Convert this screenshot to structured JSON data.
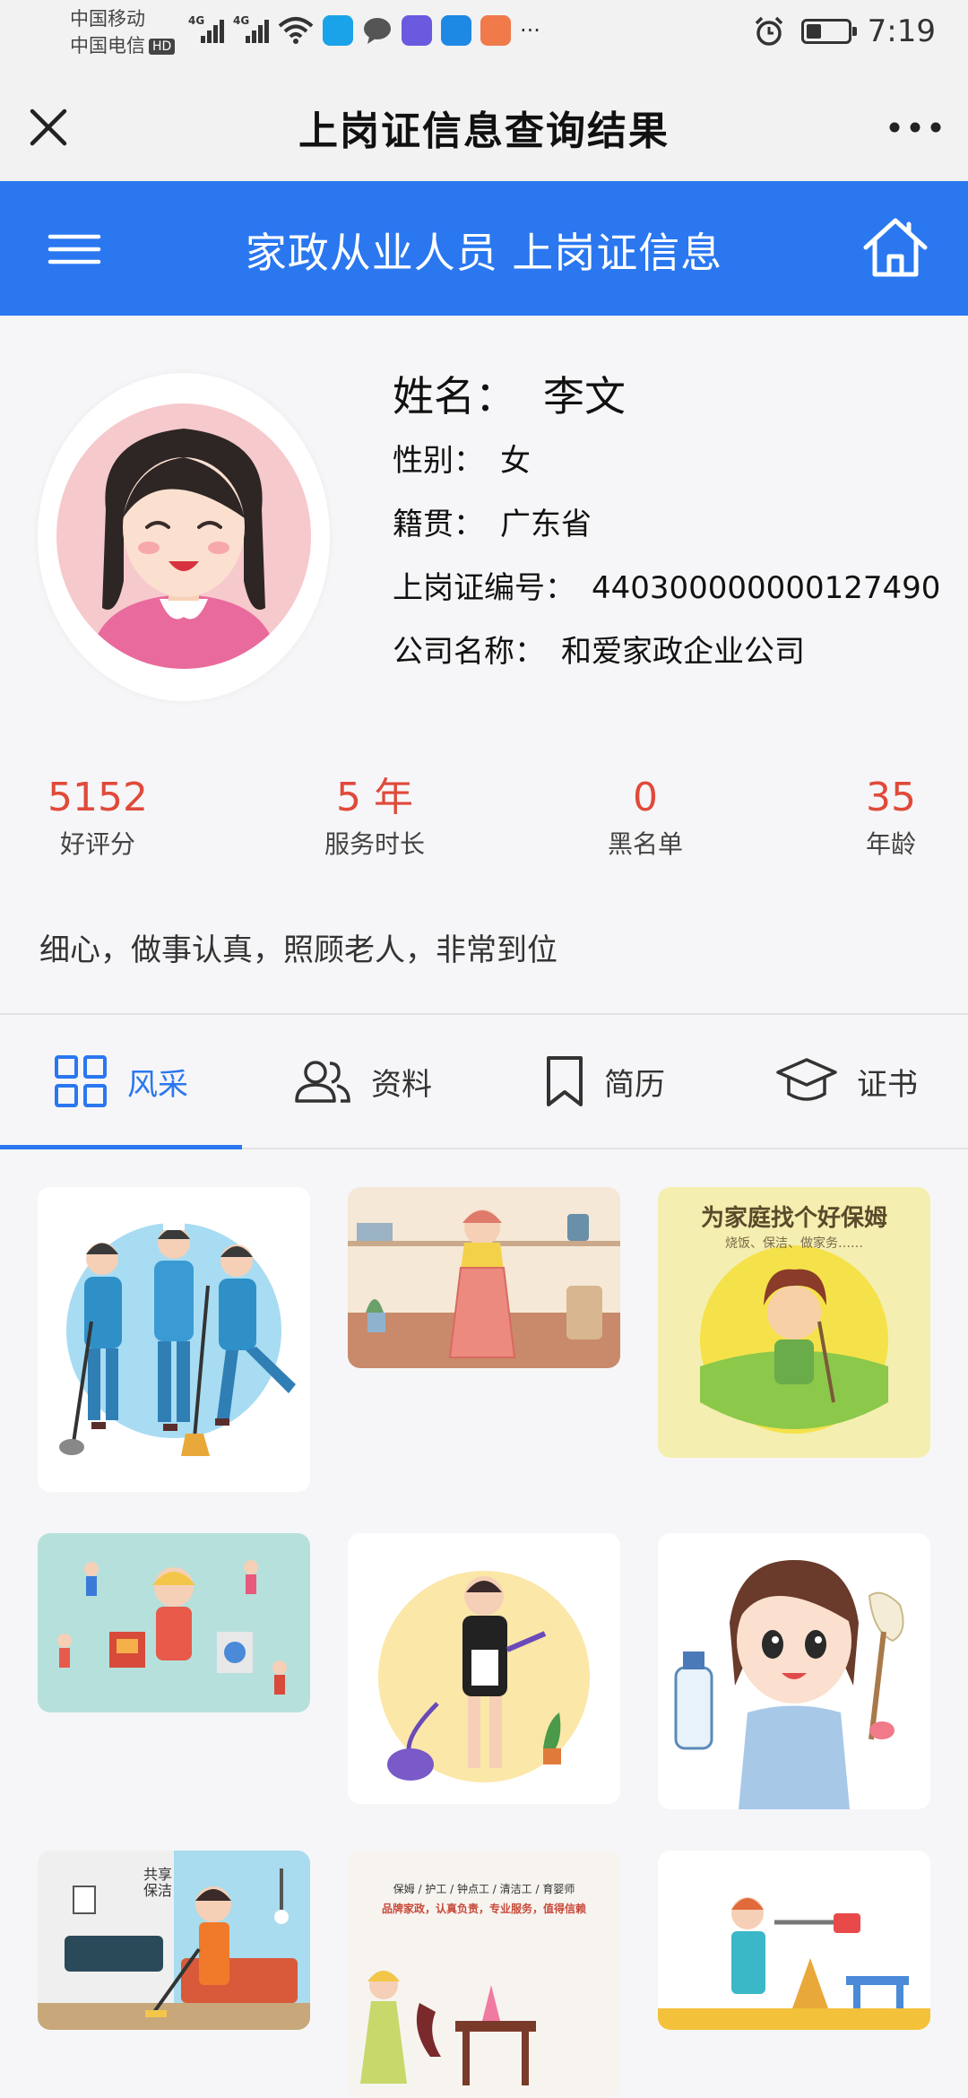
{
  "status_bar": {
    "carrier1": "中国移动",
    "carrier2": "中国电信",
    "hd": "HD",
    "signal1": "4G",
    "signal2": "4G",
    "more": "···",
    "time": "7:19"
  },
  "titlebar": {
    "title": "上岗证信息查询结果"
  },
  "header": {
    "title": "家政从业人员 上岗证信息"
  },
  "profile": {
    "name_label": "姓名：",
    "name": "李文",
    "gender_label": "性别：",
    "gender": "女",
    "origin_label": "籍贯：",
    "origin": "广东省",
    "cert_label": "上岗证编号：",
    "cert_no": "440300000000127490",
    "company_label": "公司名称：",
    "company": "和爱家政企业公司"
  },
  "stats": [
    {
      "value": "5152",
      "label": "好评分"
    },
    {
      "value": "5 年",
      "label": "服务时长"
    },
    {
      "value": "0",
      "label": "黑名单"
    },
    {
      "value": "35",
      "label": "年龄"
    }
  ],
  "description": "细心，做事认真，照顾老人，非常到位",
  "tabs": [
    {
      "label": "风采",
      "icon": "grid-icon",
      "active": true
    },
    {
      "label": "资料",
      "icon": "users-icon",
      "active": false
    },
    {
      "label": "简历",
      "icon": "bookmark-icon",
      "active": false
    },
    {
      "label": "证书",
      "icon": "graduation-cap-icon",
      "active": false
    }
  ],
  "gallery": {
    "poster3_title": "为家庭找个好保姆",
    "poster3_sub": "烧饭、保洁、做家务……",
    "poster7_text1": "共享",
    "poster7_text2": "保洁",
    "poster8_title": "保姆 / 护工 / 钟点工 / 清洁工 / 育婴师",
    "poster8_sub": "品牌家政，认真负责，专业服务，值得信赖"
  },
  "colors": {
    "primary": "#2a77f0",
    "stat": "#e04a3a"
  }
}
